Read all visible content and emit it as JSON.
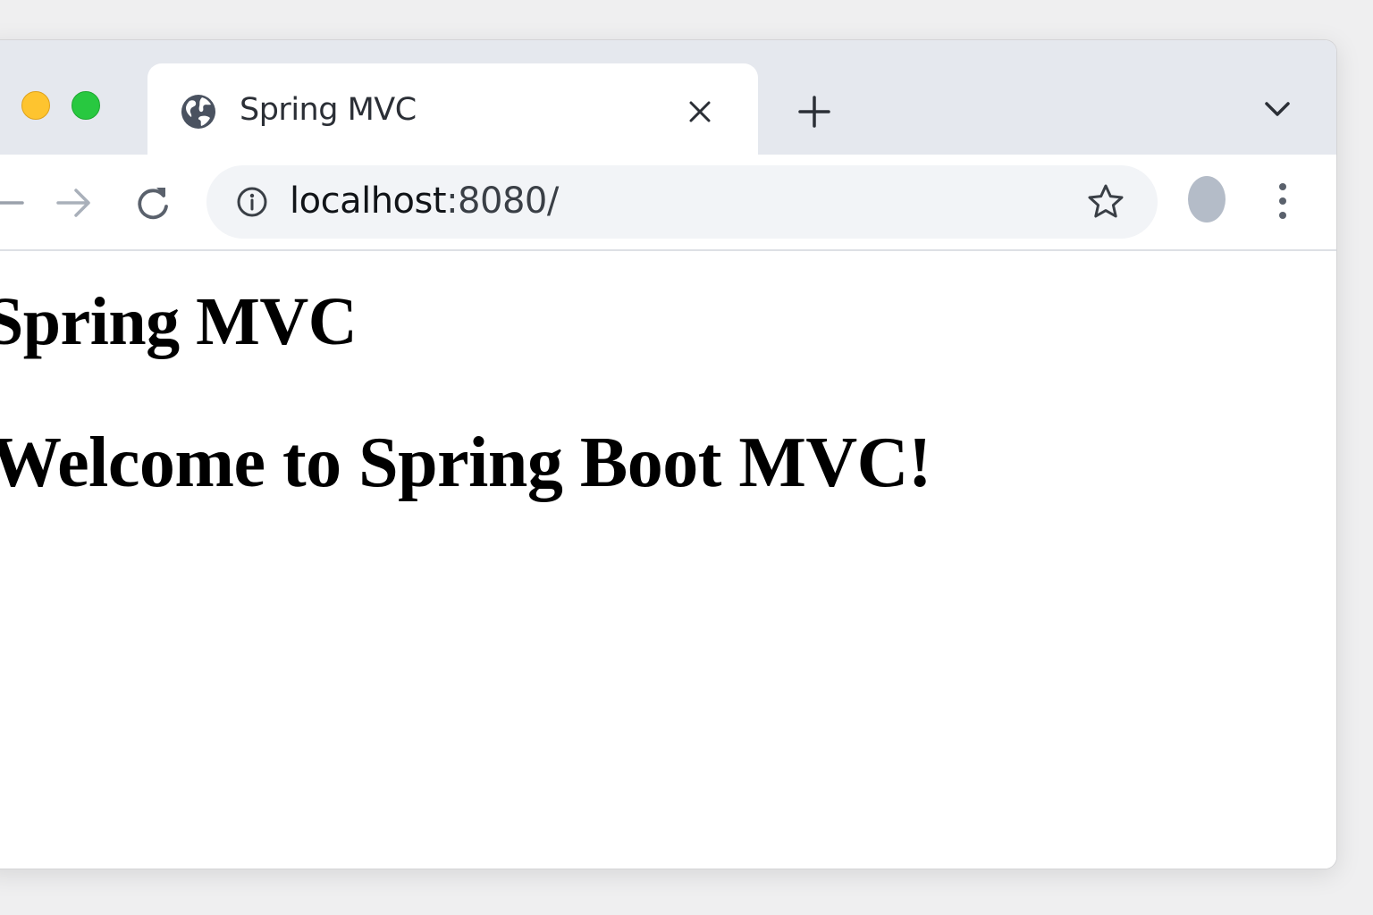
{
  "browser": {
    "tab": {
      "title": "Spring MVC",
      "favicon": "globe-icon"
    },
    "address_bar": {
      "url_host": "localhost",
      "url_rest": ":8080/"
    },
    "icons": {
      "close": "close-icon",
      "new_tab": "plus-icon",
      "tab_search": "chevron-down-icon",
      "back": "arrow-left-icon",
      "forward": "arrow-right-icon",
      "reload": "reload-icon",
      "site_info": "info-icon",
      "bookmark": "star-icon",
      "menu": "kebab-menu-icon"
    },
    "colors": {
      "traffic_yellow": "#fec42f",
      "traffic_green": "#28c840",
      "tabstrip_bg": "#e5e8ee",
      "omnibox_bg": "#f2f4f7"
    }
  },
  "page": {
    "heading": "Spring MVC",
    "welcome": "Welcome to Spring Boot MVC!"
  }
}
